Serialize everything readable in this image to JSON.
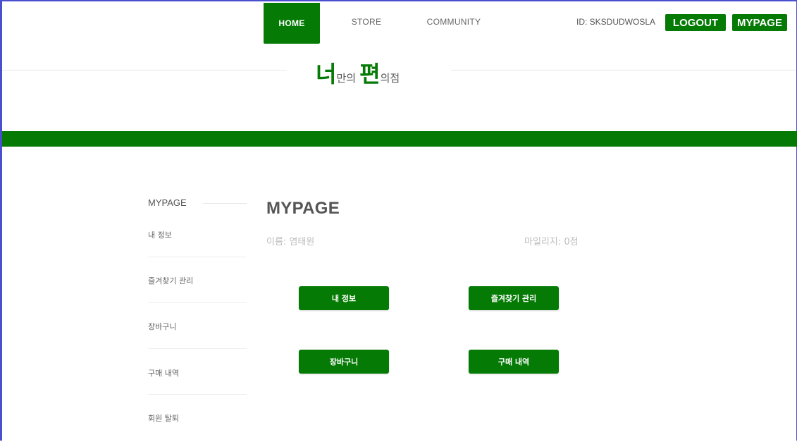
{
  "nav": {
    "home": "HOME",
    "store": "STORE",
    "community": "COMMUNITY"
  },
  "header": {
    "user_id": "ID: SKSDUDWOSLA",
    "logout": "LOGOUT",
    "mypage": "MYPAGE"
  },
  "logo": {
    "part1": "너",
    "part2": "만의",
    "part3": "편",
    "part4": "의점"
  },
  "sidebar": {
    "title": "MYPAGE",
    "items": [
      {
        "label": "내 정보"
      },
      {
        "label": "즐겨찾기 관리"
      },
      {
        "label": "장바구니"
      },
      {
        "label": "구매 내역"
      },
      {
        "label": "회원 탈퇴"
      }
    ]
  },
  "main": {
    "title": "MYPAGE",
    "name_line": "이름: 염태원",
    "mileage_line": "마일리지: 0점",
    "buttons": {
      "my_info": "내 정보",
      "favorites": "즐겨찾기 관리",
      "cart": "장바구니",
      "orders": "구매 내역"
    }
  },
  "colors": {
    "brand_green": "#057a05",
    "frame_border": "#4a4fd0"
  }
}
